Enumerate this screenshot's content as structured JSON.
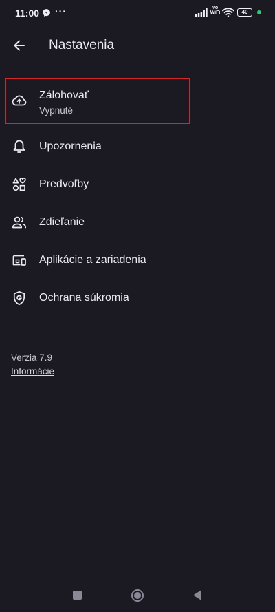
{
  "status_bar": {
    "time": "11:00",
    "more": "···",
    "vowifi_top": "Vo",
    "vowifi_bottom": "WiFi",
    "battery": "40",
    "icons": [
      "messenger-icon",
      "signal-icon",
      "wifi-icon",
      "battery-icon"
    ]
  },
  "app_bar": {
    "title": "Nastavenia",
    "back_icon": "arrow-left-icon"
  },
  "settings": {
    "items": [
      {
        "label": "Zálohovať",
        "sublabel": "Vypnuté",
        "icon": "cloud-upload-icon"
      },
      {
        "label": "Upozornenia",
        "icon": "bell-icon"
      },
      {
        "label": "Predvoľby",
        "icon": "shapes-icon"
      },
      {
        "label": "Zdieľanie",
        "icon": "people-icon"
      },
      {
        "label": "Aplikácie a zariadenia",
        "icon": "devices-icon"
      },
      {
        "label": "Ochrana súkromia",
        "icon": "shield-icon"
      }
    ]
  },
  "footer": {
    "version": "Verzia 7.9",
    "info_link": "Informácie"
  },
  "colors": {
    "background": "#1b1a22",
    "text": "#ece9f3",
    "highlight": "#d3262b",
    "status_dot": "#2ecc71"
  }
}
